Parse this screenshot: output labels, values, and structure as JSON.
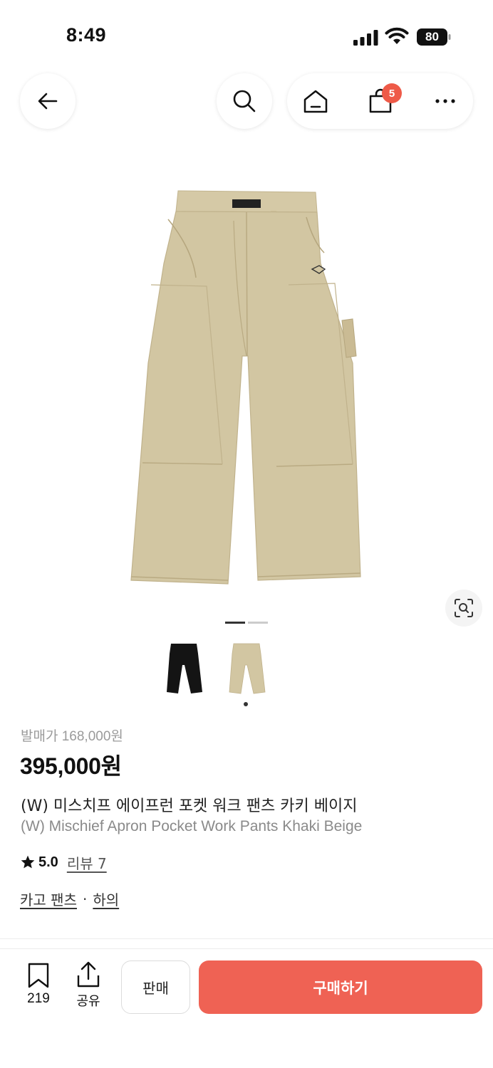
{
  "status_bar": {
    "time": "8:49",
    "battery": "80"
  },
  "nav": {
    "back_icon": "arrow-left-icon",
    "search_icon": "search-icon",
    "home_icon": "home-icon",
    "cart_icon": "shopping-bag-icon",
    "cart_count": "5",
    "more_icon": "more-horizontal-icon"
  },
  "gallery": {
    "image_index": 1,
    "image_count": 2,
    "lens_icon": "image-search-icon",
    "thumbnails": [
      {
        "color": "black"
      },
      {
        "color": "beige",
        "selected": true
      }
    ]
  },
  "product": {
    "release_price": "발매가 168,000원",
    "price": "395,000원",
    "title_ko": "(W) 미스치프 에이프런 포켓 워크 팬츠 카키 베이지",
    "title_en": "(W) Mischief Apron Pocket Work Pants Khaki Beige",
    "rating": "5.0",
    "review_link": "리뷰 7",
    "categories": [
      "카고 팬츠",
      "하의"
    ],
    "category_separator": "·"
  },
  "bottom_bar": {
    "bookmark_icon": "bookmark-icon",
    "bookmark_count": "219",
    "share_icon": "share-icon",
    "share_label": "공유",
    "sell_label": "판매",
    "buy_label": "구매하기"
  },
  "colors": {
    "accent": "#ef6254",
    "badge": "#ee5a48",
    "product_khaki": "#d2c6a2"
  }
}
